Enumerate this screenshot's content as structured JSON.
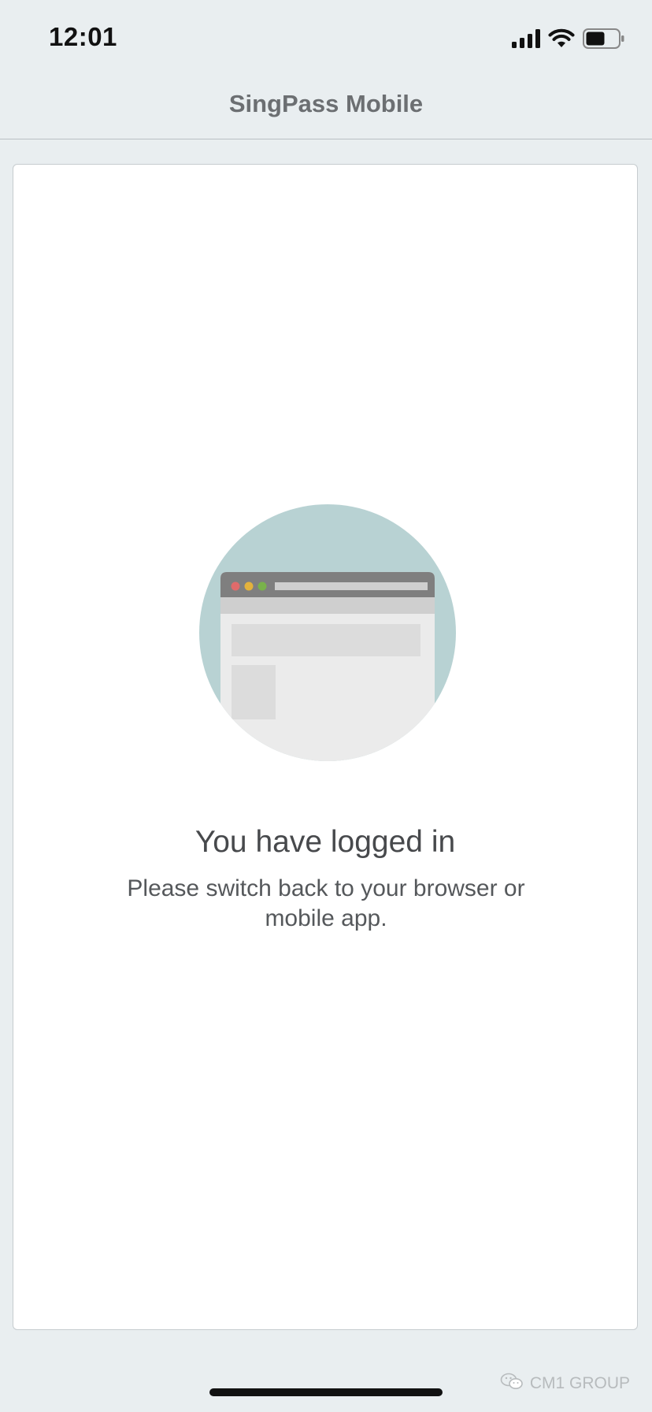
{
  "status_bar": {
    "time": "12:01",
    "icons": [
      "cellular-signal-icon",
      "wifi-icon",
      "battery-icon"
    ]
  },
  "header": {
    "title": "SingPass Mobile"
  },
  "main": {
    "illustration_icon": "browser-window-icon",
    "heading": "You have logged in",
    "message": "Please switch back to your browser or mobile app."
  },
  "watermark": {
    "icon": "wechat-icon",
    "text": "CM1 GROUP"
  },
  "colors": {
    "background": "#e9eef0",
    "card": "#ffffff",
    "illustration_circle": "#b8d2d3",
    "browser_bar": "#7f7f7f",
    "dot_red": "#e06b6b",
    "dot_yellow": "#e3b23c",
    "dot_green": "#79b24b"
  }
}
